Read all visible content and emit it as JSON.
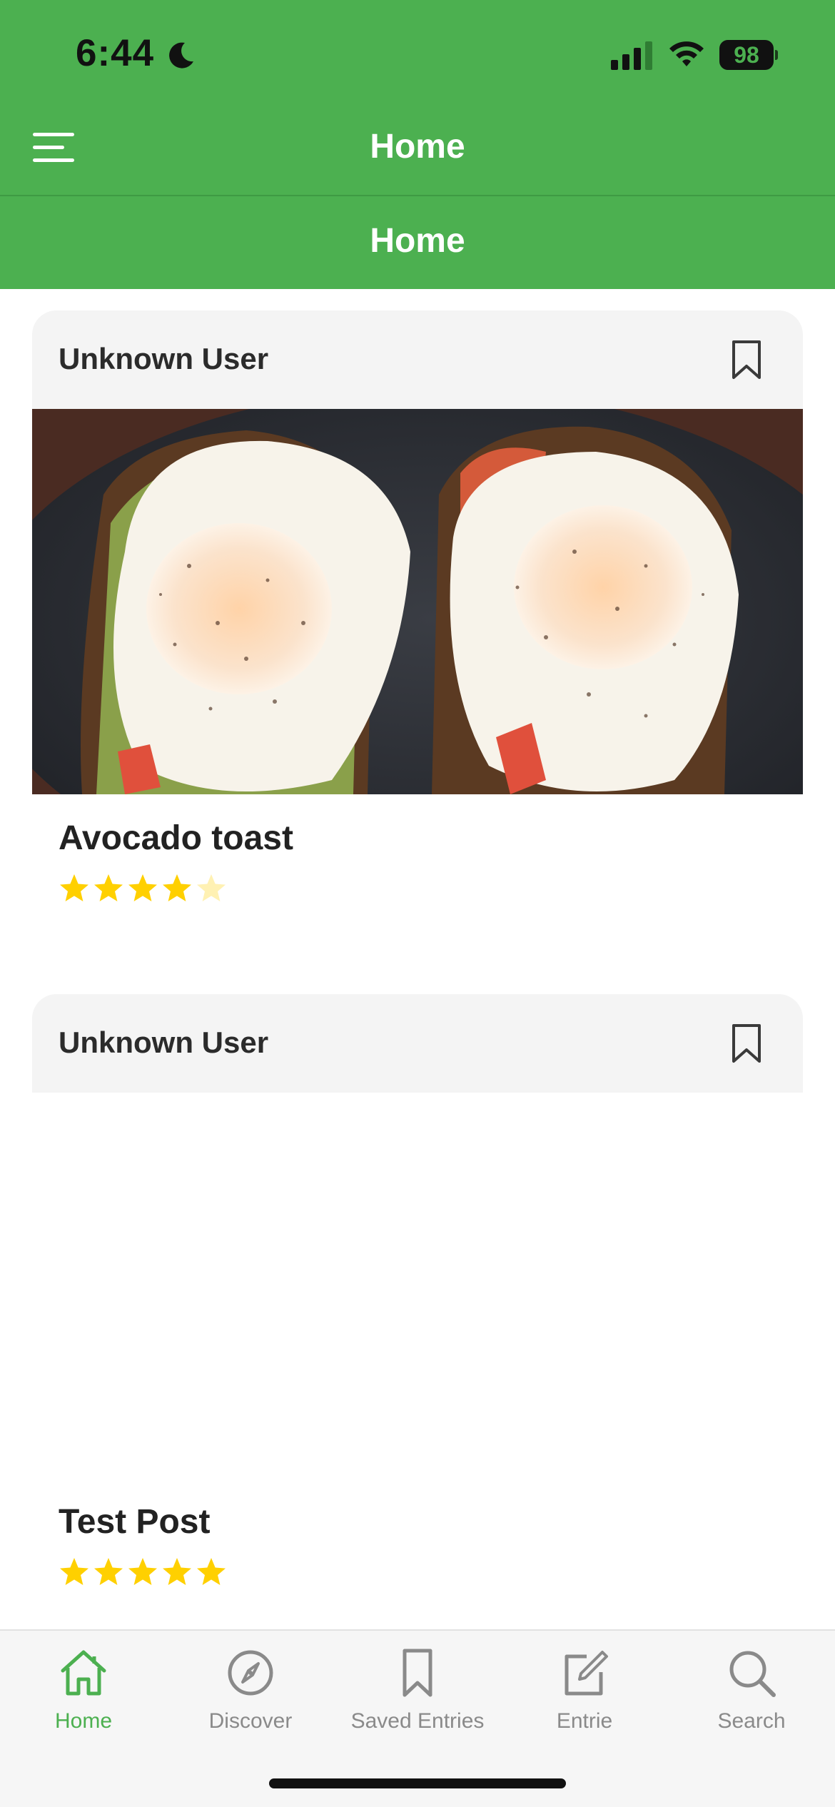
{
  "status_bar": {
    "time": "6:44",
    "battery": "98"
  },
  "nav": {
    "title": "Home",
    "subtitle": "Home",
    "menu_icon": "hamburger-menu-icon"
  },
  "posts": [
    {
      "user": "Unknown User",
      "title": "Avocado toast",
      "rating": 4,
      "max_rating": 5,
      "image": "avocado-toast-with-fried-eggs-photo"
    },
    {
      "user": "Unknown User",
      "title": "Test Post",
      "rating": 5,
      "max_rating": 5
    }
  ],
  "tabs": [
    {
      "label": "Home",
      "icon": "home-icon",
      "active": true
    },
    {
      "label": "Discover",
      "icon": "compass-icon",
      "active": false
    },
    {
      "label": "Saved Entries",
      "icon": "bookmark-icon",
      "active": false
    },
    {
      "label": "Entrie",
      "icon": "edit-icon",
      "active": false
    },
    {
      "label": "Search",
      "icon": "search-icon",
      "active": false
    }
  ],
  "colors": {
    "brand": "#4cb050",
    "star": "#ffd000",
    "star_empty": "#fff1b3",
    "tab_inactive": "#8a8a8a"
  }
}
